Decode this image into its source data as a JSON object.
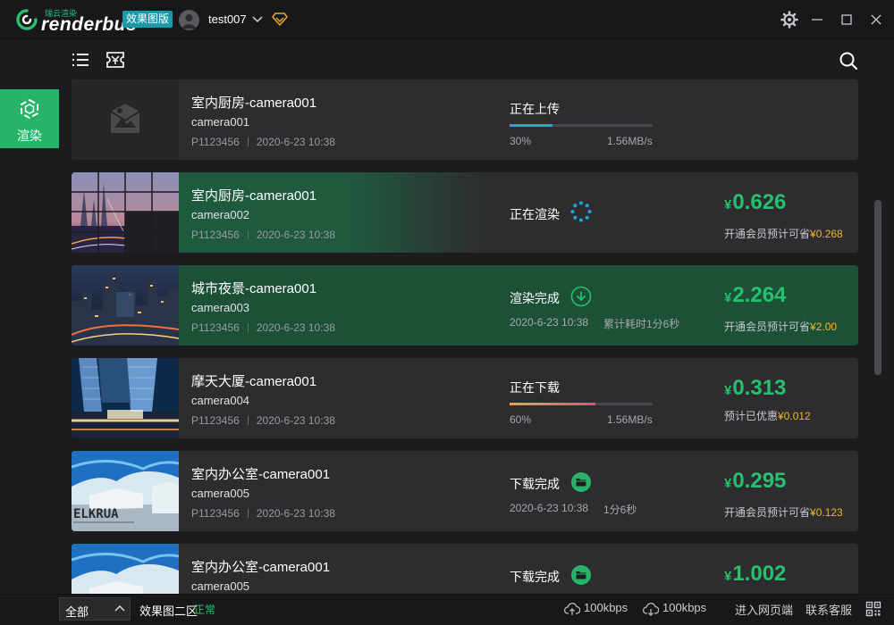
{
  "app": {
    "brand_sub": "瑞云渲染",
    "brand": "renderbus",
    "edition": "效果图版",
    "username": "test007"
  },
  "sidebar": {
    "render_label": "渲染"
  },
  "tasks": [
    {
      "title": "室内厨房-camera001",
      "camera": "camera001",
      "project": "P1123456",
      "date": "2020-6-23 10:38",
      "status": "正在上传",
      "progress_pct": "30%",
      "progress_value": 0.3,
      "speed": "1.56MB/s",
      "thumb": "placeholder"
    },
    {
      "title": "室内厨房-camera001",
      "camera": "camera002",
      "project": "P1123456",
      "date": "2020-6-23 10:38",
      "status": "正在渲染",
      "price_currency": "¥",
      "price": "0.626",
      "saving_text": "开通会员预计可省",
      "saving_amount": "¥0.268",
      "thumb": "city-bridge"
    },
    {
      "title": "城市夜景-camera001",
      "camera": "camera003",
      "project": "P1123456",
      "date": "2020-6-23 10:38",
      "status": "渲染完成",
      "done_time": "2020-6-23 10:38",
      "elapsed": "累计耗时1分6秒",
      "price_currency": "¥",
      "price": "2.264",
      "saving_text": "开通会员预计可省",
      "saving_amount": "¥2.00",
      "thumb": "city-night"
    },
    {
      "title": "摩天大厦-camera001",
      "camera": "camera004",
      "project": "P1123456",
      "date": "2020-6-23 10:38",
      "status": "正在下载",
      "progress_pct": "60%",
      "progress_value": 0.6,
      "speed": "1.56MB/s",
      "price_currency": "¥",
      "price": "0.313",
      "saving_text": "预计已优惠",
      "saving_amount": "¥0.012",
      "thumb": "skyscraper"
    },
    {
      "title": "室内办公室-camera001",
      "camera": "camera005",
      "project": "P1123456",
      "date": "2020-6-23 10:38",
      "status": "下载完成",
      "done_time": "2020-6-23 10:38",
      "elapsed": "1分6秒",
      "price_currency": "¥",
      "price": "0.295",
      "saving_text": "开通会员预计可省",
      "saving_amount": "¥0.123",
      "thumb": "office",
      "thumb_text": "ELKRUA"
    },
    {
      "title": "室内办公室-camera001",
      "camera": "camera005",
      "status": "下载完成",
      "price_currency": "¥",
      "price": "1.002",
      "thumb": "office"
    }
  ],
  "bottom": {
    "filter": "全部",
    "zone": "效果图二区",
    "zone_status": "正常",
    "upload_speed": "100kbps",
    "download_speed": "100kbps",
    "web_link": "进入网页端",
    "support_link": "联系客服"
  },
  "colors": {
    "accent": "#26b568",
    "price": "#26c06e",
    "saving": "#f0b628",
    "upload_progress": "#1ea6e0",
    "download_progress": "#e0507a"
  },
  "icons": {
    "settings": "gear-icon",
    "minimize": "minimize-icon",
    "maximize": "maximize-icon",
    "close": "close-icon",
    "search": "search-icon",
    "list_view": "list-view-icon",
    "ticket": "ticket-icon"
  }
}
